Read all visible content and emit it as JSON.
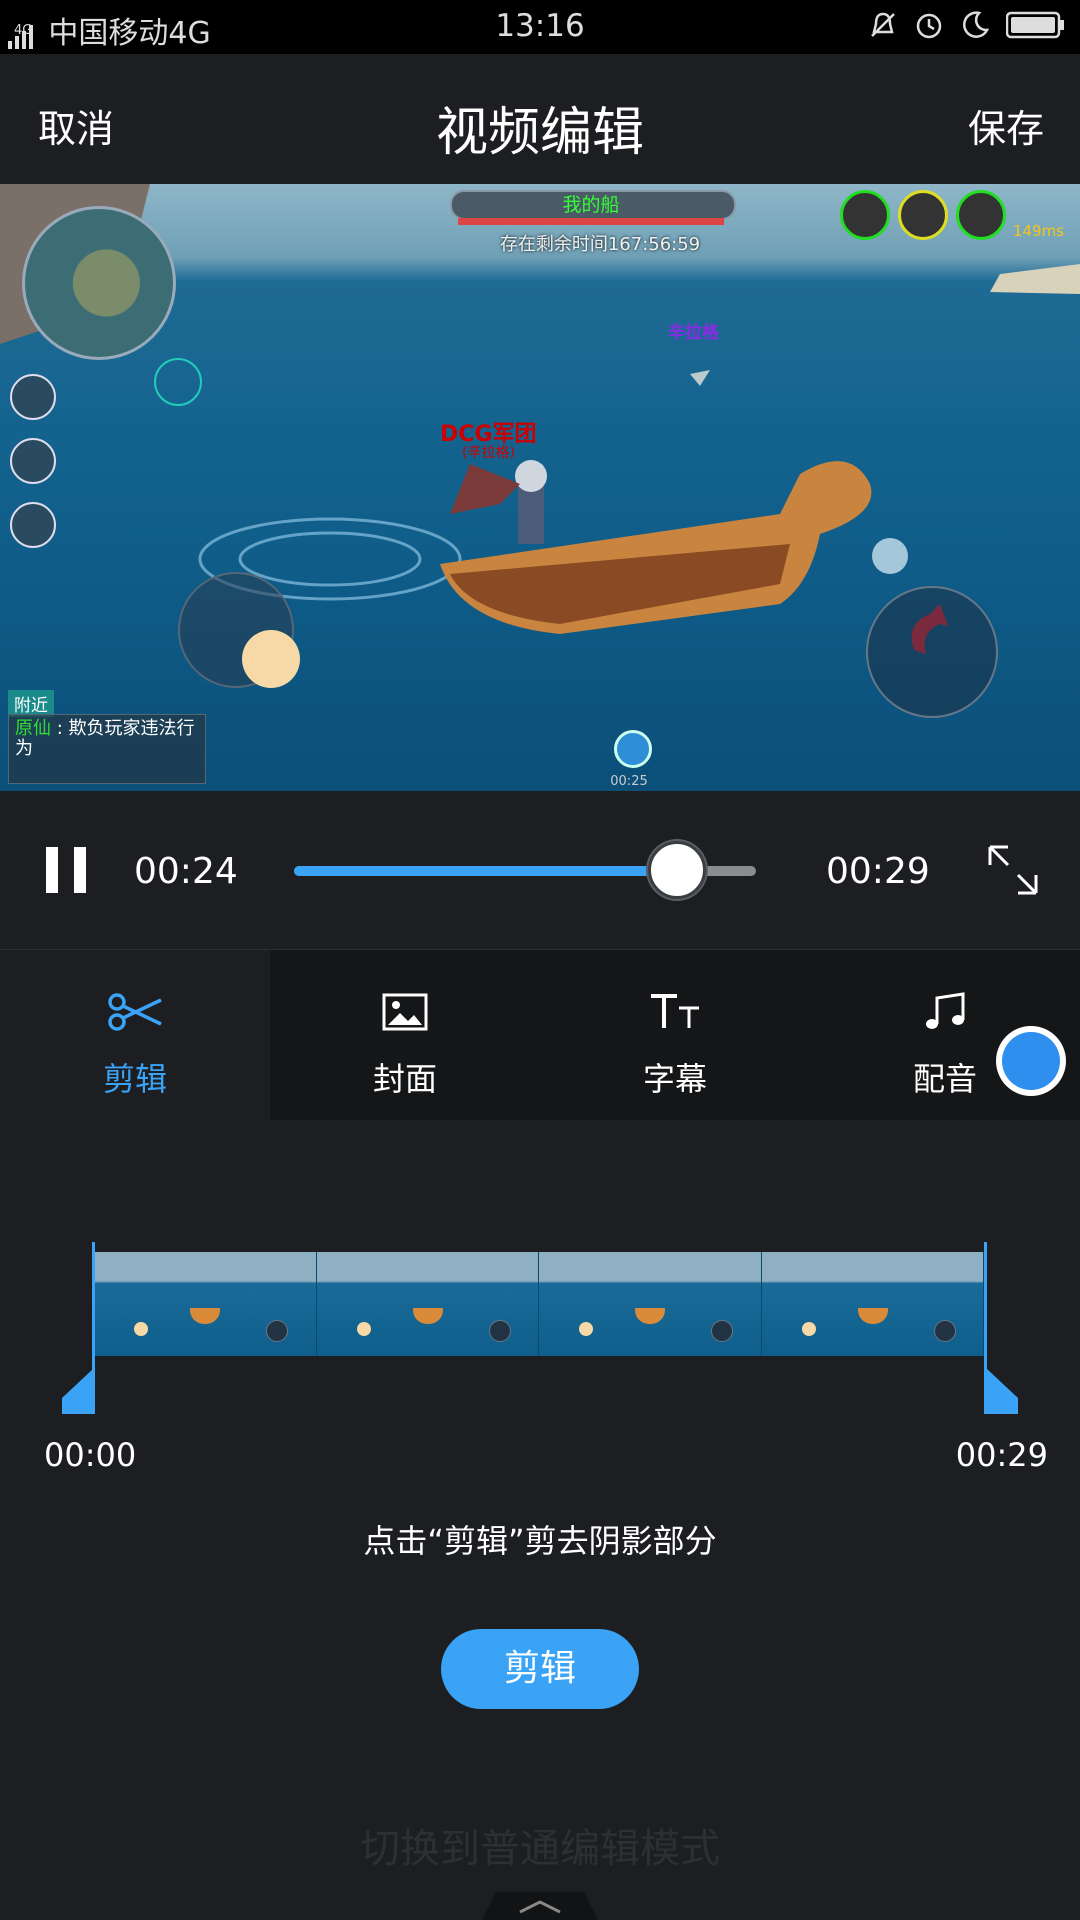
{
  "status_bar": {
    "network_type": "4G",
    "carrier": "中国移动4G",
    "time": "13:16",
    "icons": [
      "signal-icon",
      "bell-muted-icon",
      "alarm-icon",
      "moon-icon",
      "battery-icon"
    ]
  },
  "header": {
    "cancel_label": "取消",
    "title": "视频编辑",
    "save_label": "保存"
  },
  "video": {
    "game_hud": {
      "boat_label": "我的船",
      "timer_text": "存在剩余时间167:56:59",
      "ping": "149ms",
      "enemy_name": "DCG军团",
      "enemy_sub": "(辛拉格)",
      "player2_name": "辛拉格",
      "chat_channel": "附近",
      "chat_sender": "原仙",
      "chat_message": "欺负玩家违法行为",
      "record_time": "00:25"
    }
  },
  "player": {
    "current_time": "00:24",
    "total_time": "00:29",
    "progress_fraction": 0.83
  },
  "tabs": [
    {
      "label": "剪辑",
      "icon": "scissors-icon",
      "active": true
    },
    {
      "label": "封面",
      "icon": "image-icon",
      "active": false
    },
    {
      "label": "字幕",
      "icon": "text-size-icon",
      "active": false
    },
    {
      "label": "配音",
      "icon": "music-note-icon",
      "active": false
    }
  ],
  "timeline": {
    "start_time": "00:00",
    "end_time": "00:29",
    "frame_count": 4
  },
  "hint_text": "点击“剪辑”剪去阴影部分",
  "cut_button_label": "剪辑",
  "switch_mode_label": "切换到普通编辑模式",
  "colors": {
    "accent": "#3aa3f5",
    "background": "#1c1e21",
    "tab_bar": "#151618"
  }
}
